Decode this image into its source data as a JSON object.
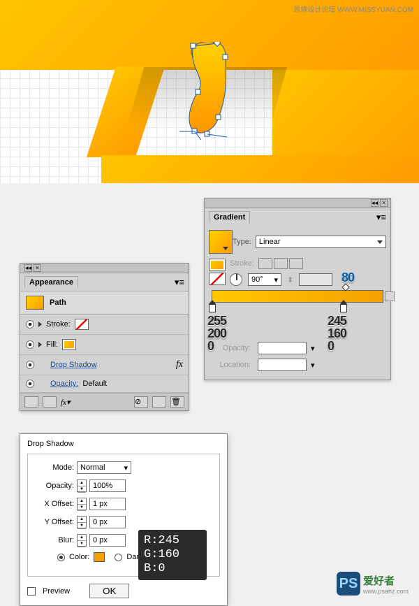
{
  "watermark_top": "思缘设计论坛  WWW.MISSYUAN.COM",
  "appearance": {
    "title": "Appearance",
    "object": "Path",
    "stroke_label": "Stroke:",
    "fill_label": "Fill:",
    "effect": "Drop Shadow",
    "opacity_label": "Opacity:",
    "opacity_value": "Default",
    "fx_label": "fx"
  },
  "gradient": {
    "title": "Gradient",
    "type_label": "Type:",
    "type_value": "Linear",
    "stroke_label": "Stroke:",
    "angle": "90°",
    "ratio_val": "",
    "opacity_label": "Opacity:",
    "location_label": "Location:",
    "annot_80": "80",
    "stop1": {
      "r": "255",
      "g": "200",
      "b": "0"
    },
    "stop2": {
      "r": "245",
      "g": "160",
      "b": "0"
    }
  },
  "drop_shadow": {
    "title": "Drop Shadow",
    "mode_label": "Mode:",
    "mode_value": "Normal",
    "opacity_label": "Opacity:",
    "opacity_value": "100%",
    "xoffset_label": "X Offset:",
    "xoffset_value": "1 px",
    "yoffset_label": "Y Offset:",
    "yoffset_value": "0 px",
    "blur_label": "Blur:",
    "blur_value": "0 px",
    "color_label": "Color:",
    "darkness_label": "Dark",
    "preview_label": "Preview",
    "ok": "OK"
  },
  "rgb": {
    "r": "R:245",
    "g": "G:160",
    "b": "B:0"
  },
  "logo": {
    "ps": "PS",
    "cn": "爱好者",
    "url": "www.psahz.com"
  }
}
